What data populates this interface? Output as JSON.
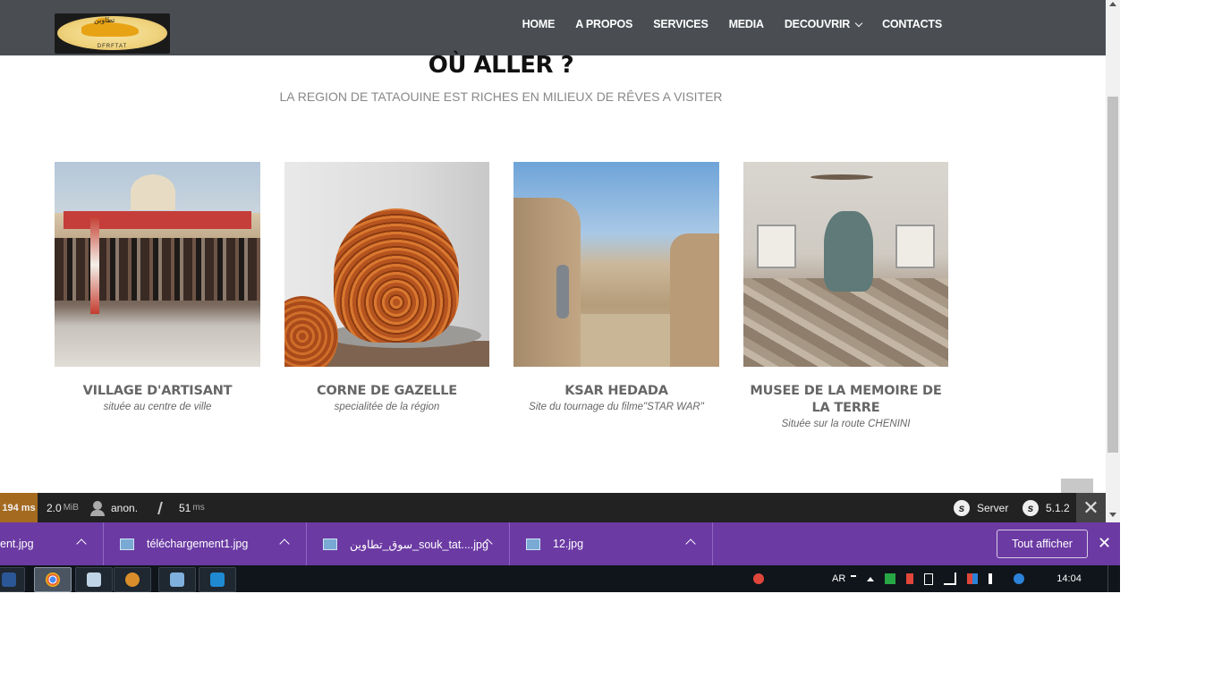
{
  "site": {
    "logo_text": "DFRFTAT",
    "logo_arabic": "تطاوين",
    "nav": [
      "HOME",
      "A PROPOS",
      "SERVICES",
      "MEDIA",
      "DECOUVRIR",
      "CONTACTS"
    ]
  },
  "section": {
    "title": "OÙ ALLER ?",
    "subtitle": "LA REGION DE TATAOUINE EST RICHES EN MILIEUX DE RÊVES A VISITER",
    "cards": [
      {
        "name": "VILLAGE D'ARTISANT",
        "desc": "située au centre de ville"
      },
      {
        "name": "CORNE DE GAZELLE",
        "desc": "specialitée de la région"
      },
      {
        "name": "KSAR HEDADA",
        "desc": "Site du tournage du filme\"STAR WAR\""
      },
      {
        "name": "MUSEE DE LA MEMOIRE DE LA TERRE",
        "desc": "Située sur la route CHENINI"
      }
    ]
  },
  "debugbar": {
    "time": "194",
    "time_unit": "ms",
    "memory": "2.0",
    "memory_unit": "MiB",
    "user": "anon.",
    "db_time": "51",
    "db_unit": "ms",
    "server": "Server",
    "version": "5.1.2",
    "close": "✕"
  },
  "downloads": {
    "items": [
      "ent.jpg",
      "téléchargement1.jpg",
      "سوق_تطاوين_souk_tat....jpg",
      "12.jpg"
    ],
    "show_all": "Tout afficher",
    "close": "✕"
  },
  "taskbar": {
    "lang": "AR",
    "clock": "14:04"
  },
  "colors": {
    "header_bg": "#4a4e53",
    "downloads_bg": "#6b3aa3",
    "debug_time_bg": "#a46a1f"
  }
}
